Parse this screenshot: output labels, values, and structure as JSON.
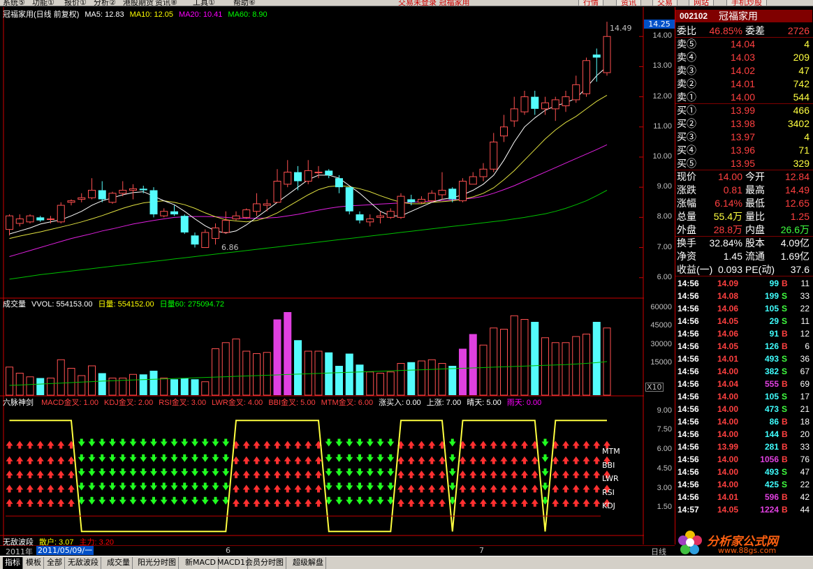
{
  "menu": {
    "items": [
      "系统⑤",
      "功能①",
      "报价①",
      "分析②",
      "港股期货",
      "资讯⑧",
      "工具①",
      "帮助⑥"
    ],
    "status": "交易未登录  冠福家用",
    "buttons": [
      "行情",
      "资讯",
      "交易",
      "网站",
      "手机炒股"
    ]
  },
  "stock": {
    "code": "002102",
    "name": "冠福家用"
  },
  "price_header": {
    "title": "冠福家用(日线 前复权)",
    "ma5": "MA5: 12.83",
    "ma10": "MA10: 12.05",
    "ma20": "MA20: 10.41",
    "ma60": "MA60: 8.90",
    "current_tag": "14.25",
    "high_label": "14.49",
    "low_label": "6.86"
  },
  "vol_header": {
    "title": "成交量",
    "vvol": "VVOL: 554153.00",
    "day": "日量: 554152.00",
    "day60": "日量60: 275094.72",
    "x10": "X10"
  },
  "ind_header": {
    "title": "六脉神剑",
    "items": [
      "MACD金叉: 1.00",
      "KDJ金叉: 2.00",
      "RSI金叉: 3.00",
      "LWR金叉: 4.00",
      "BBI金叉: 5.00",
      "MTM金叉: 6.00",
      "涨买入: 0.00",
      "上涨: 7.00",
      "晴天: 5.00",
      "雨天: 0.00"
    ]
  },
  "ind_labels": [
    "MTM",
    "BBI",
    "LWR",
    "RSI",
    "KDJ"
  ],
  "bottom_ind": {
    "title": "无敌波段",
    "retail": "散户: 3.07",
    "main": "主力: 3.20"
  },
  "price_axis": [
    "14.00",
    "13.00",
    "12.00",
    "11.00",
    "10.00",
    "9.00",
    "8.00",
    "7.00",
    "6.00"
  ],
  "vol_axis": [
    "60000",
    "45000",
    "30000",
    "15000"
  ],
  "ind_axis": [
    "9.00",
    "7.50",
    "6.00",
    "4.50",
    "3.00",
    "1.50"
  ],
  "date_bar": {
    "year": "2011年",
    "date_input": "2011/05/09/一",
    "m6": "6",
    "m7": "7",
    "period": "日线"
  },
  "panel": {
    "weibi": {
      "label": "委比",
      "value": "46.85%",
      "label2": "委差",
      "value2": "2726"
    },
    "asks": [
      {
        "label": "卖⑤",
        "price": "14.04",
        "vol": "4"
      },
      {
        "label": "卖④",
        "price": "14.03",
        "vol": "209"
      },
      {
        "label": "卖③",
        "price": "14.02",
        "vol": "47"
      },
      {
        "label": "卖②",
        "price": "14.01",
        "vol": "742"
      },
      {
        "label": "卖①",
        "price": "14.00",
        "vol": "544"
      }
    ],
    "bids": [
      {
        "label": "买①",
        "price": "13.99",
        "vol": "466"
      },
      {
        "label": "买②",
        "price": "13.98",
        "vol": "3402"
      },
      {
        "label": "买③",
        "price": "13.97",
        "vol": "4"
      },
      {
        "label": "买④",
        "price": "13.96",
        "vol": "71"
      },
      {
        "label": "买⑤",
        "price": "13.95",
        "vol": "329"
      }
    ],
    "quote": [
      {
        "l1": "现价",
        "v1": "14.00",
        "l2": "今开",
        "v2": "12.84"
      },
      {
        "l1": "涨跌",
        "v1": "0.81",
        "l2": "最高",
        "v2": "14.49"
      },
      {
        "l1": "涨幅",
        "v1": "6.14%",
        "l2": "最低",
        "v2": "12.65"
      },
      {
        "l1": "总量",
        "v1": "55.4万",
        "l2": "量比",
        "v2": "1.25"
      },
      {
        "l1": "外盘",
        "v1": "28.8万",
        "l2": "内盘",
        "v2": "26.6万"
      }
    ],
    "fund": [
      {
        "l1": "换手",
        "v1": "32.84%",
        "l2": "股本",
        "v2": "4.09亿"
      },
      {
        "l1": "净资",
        "v1": "1.45",
        "l2": "流通",
        "v2": "1.69亿"
      },
      {
        "l1": "收益(一)",
        "v1": "0.093",
        "l2": "PE(动)",
        "v2": "37.6"
      }
    ],
    "ticks": [
      {
        "t": "14:56",
        "p": "14.09",
        "v": "99",
        "s": "B",
        "n": "11"
      },
      {
        "t": "14:56",
        "p": "14.08",
        "v": "199",
        "s": "S",
        "n": "33"
      },
      {
        "t": "14:56",
        "p": "14.06",
        "v": "105",
        "s": "S",
        "n": "22"
      },
      {
        "t": "14:56",
        "p": "14.05",
        "v": "29",
        "s": "S",
        "n": "11"
      },
      {
        "t": "14:56",
        "p": "14.06",
        "v": "91",
        "s": "B",
        "n": "12"
      },
      {
        "t": "14:56",
        "p": "14.05",
        "v": "126",
        "s": "B",
        "n": "6"
      },
      {
        "t": "14:56",
        "p": "14.01",
        "v": "493",
        "s": "S",
        "n": "36"
      },
      {
        "t": "14:56",
        "p": "14.00",
        "v": "382",
        "s": "S",
        "n": "67"
      },
      {
        "t": "14:56",
        "p": "14.04",
        "v": "555",
        "s": "B",
        "n": "69"
      },
      {
        "t": "14:56",
        "p": "14.00",
        "v": "105",
        "s": "S",
        "n": "17"
      },
      {
        "t": "14:56",
        "p": "14.00",
        "v": "473",
        "s": "S",
        "n": "21"
      },
      {
        "t": "14:56",
        "p": "14.00",
        "v": "86",
        "s": "B",
        "n": "18"
      },
      {
        "t": "14:56",
        "p": "14.00",
        "v": "144",
        "s": "B",
        "n": "20"
      },
      {
        "t": "14:56",
        "p": "13.99",
        "v": "281",
        "s": "B",
        "n": "33"
      },
      {
        "t": "14:56",
        "p": "14.00",
        "v": "1056",
        "s": "B",
        "n": "76"
      },
      {
        "t": "14:56",
        "p": "14.00",
        "v": "493",
        "s": "S",
        "n": "47"
      },
      {
        "t": "14:56",
        "p": "14.00",
        "v": "425",
        "s": "S",
        "n": "22"
      },
      {
        "t": "14:56",
        "p": "14.01",
        "v": "596",
        "s": "B",
        "n": "42"
      },
      {
        "t": "14:57",
        "p": "14.05",
        "v": "1224",
        "s": "B",
        "n": "44"
      }
    ]
  },
  "watermark": {
    "site": "分析家公式网",
    "url": "www.88gs.com"
  },
  "bottom_tabs": [
    "指标",
    "模板",
    "全部",
    "无敌波段",
    "成交量",
    "阳光分时图",
    "新MACD",
    "MACD1",
    "会员分时图",
    "超级解盘"
  ],
  "chart_data": {
    "type": "candlestick",
    "ylim": [
      5.6,
      14.7
    ],
    "candles": [
      [
        7.6,
        8.05,
        7.4,
        8.1
      ],
      [
        7.8,
        7.95,
        7.7,
        8.1
      ],
      [
        7.85,
        8.05,
        7.8,
        8.1
      ],
      [
        8.0,
        7.9,
        7.85,
        8.05
      ],
      [
        7.95,
        7.95,
        7.8,
        8.05
      ],
      [
        7.85,
        8.4,
        7.8,
        8.5
      ],
      [
        8.5,
        8.55,
        8.4,
        8.6
      ],
      [
        8.6,
        8.65,
        8.5,
        8.8
      ],
      [
        8.65,
        8.9,
        8.6,
        9.3
      ],
      [
        8.9,
        8.6,
        8.5,
        9.2
      ],
      [
        8.5,
        8.8,
        8.45,
        8.85
      ],
      [
        8.8,
        8.9,
        8.7,
        9.2
      ],
      [
        8.9,
        8.95,
        8.6,
        9.1
      ],
      [
        8.95,
        8.9,
        8.8,
        9.05
      ],
      [
        8.9,
        8.1,
        8.0,
        9.0
      ],
      [
        8.05,
        8.2,
        8.0,
        8.3
      ],
      [
        8.2,
        8.1,
        8.05,
        8.4
      ],
      [
        8.05,
        7.5,
        7.45,
        8.1
      ],
      [
        7.4,
        7.1,
        7.0,
        7.5
      ],
      [
        7.0,
        7.5,
        7.0,
        7.6
      ],
      [
        7.3,
        7.65,
        7.1,
        7.8
      ],
      [
        7.5,
        7.9,
        7.45,
        8.2
      ],
      [
        7.95,
        8.05,
        7.9,
        8.2
      ],
      [
        8.0,
        8.25,
        7.95,
        8.3
      ],
      [
        8.2,
        8.45,
        8.05,
        8.8
      ],
      [
        8.4,
        8.45,
        8.2,
        8.6
      ],
      [
        8.5,
        9.2,
        8.5,
        9.6
      ],
      [
        9.1,
        9.5,
        9.0,
        9.9
      ],
      [
        9.5,
        9.2,
        8.9,
        9.7
      ],
      [
        9.2,
        9.55,
        9.1,
        9.9
      ],
      [
        9.5,
        9.5,
        9.3,
        9.7
      ],
      [
        9.55,
        9.4,
        9.3,
        9.6
      ],
      [
        9.3,
        9.0,
        8.8,
        9.4
      ],
      [
        9.0,
        8.2,
        8.1,
        9.0
      ],
      [
        8.1,
        7.9,
        7.8,
        8.2
      ],
      [
        7.85,
        7.95,
        7.7,
        8.1
      ],
      [
        8.0,
        8.05,
        7.8,
        8.2
      ],
      [
        8.0,
        8.2,
        7.95,
        8.3
      ],
      [
        8.0,
        8.7,
        7.95,
        8.8
      ],
      [
        8.6,
        8.5,
        8.4,
        8.75
      ],
      [
        8.5,
        8.6,
        8.45,
        8.7
      ],
      [
        8.55,
        8.8,
        8.5,
        8.9
      ],
      [
        8.75,
        8.9,
        8.6,
        9.5
      ],
      [
        8.95,
        8.6,
        8.5,
        9.0
      ],
      [
        8.55,
        9.2,
        8.5,
        9.3
      ],
      [
        9.1,
        9.35,
        9.1,
        9.5
      ],
      [
        9.35,
        9.6,
        9.2,
        9.8
      ],
      [
        9.6,
        10.5,
        9.5,
        10.8
      ],
      [
        10.7,
        11.0,
        10.5,
        11.4
      ],
      [
        11.2,
        11.6,
        11.0,
        12.0
      ],
      [
        11.5,
        12.0,
        11.4,
        12.2
      ],
      [
        12.0,
        11.6,
        11.4,
        12.2
      ],
      [
        11.6,
        11.8,
        11.4,
        12.0
      ],
      [
        11.6,
        11.9,
        11.2,
        12.0
      ],
      [
        11.7,
        12.0,
        11.5,
        12.2
      ],
      [
        11.9,
        12.4,
        11.8,
        12.7
      ],
      [
        12.1,
        13.2,
        12.0,
        13.3
      ],
      [
        13.4,
        13.3,
        12.5,
        13.6
      ],
      [
        12.8,
        14.0,
        12.7,
        14.49
      ]
    ],
    "ma5": [
      7.45,
      7.55,
      7.65,
      7.78,
      7.85,
      7.92,
      8.05,
      8.2,
      8.4,
      8.55,
      8.65,
      8.75,
      8.82,
      8.85,
      8.7,
      8.55,
      8.42,
      8.2,
      7.95,
      7.72,
      7.55,
      7.48,
      7.55,
      7.75,
      8.0,
      8.25,
      8.5,
      8.75,
      9.0,
      9.25,
      9.4,
      9.4,
      9.3,
      9.05,
      8.8,
      8.5,
      8.2,
      8.05,
      8.05,
      8.2,
      8.35,
      8.5,
      8.6,
      8.65,
      8.75,
      8.9,
      9.1,
      9.4,
      9.9,
      10.5,
      11.0,
      11.3,
      11.55,
      11.7,
      11.8,
      11.95,
      12.3,
      12.7,
      13.0
    ],
    "ma10": [
      7.3,
      7.38,
      7.45,
      7.52,
      7.6,
      7.68,
      7.76,
      7.85,
      7.95,
      8.06,
      8.18,
      8.3,
      8.4,
      8.48,
      8.52,
      8.55,
      8.5,
      8.42,
      8.3,
      8.15,
      8.02,
      7.92,
      7.88,
      7.85,
      7.9,
      8.0,
      8.15,
      8.35,
      8.55,
      8.75,
      8.92,
      9.02,
      9.05,
      9.02,
      8.95,
      8.85,
      8.72,
      8.6,
      8.5,
      8.45,
      8.45,
      8.5,
      8.52,
      8.55,
      8.6,
      8.68,
      8.8,
      8.98,
      9.25,
      9.55,
      9.9,
      10.25,
      10.6,
      10.9,
      11.15,
      11.35,
      11.6,
      11.85,
      12.05
    ],
    "ma20": [
      6.7,
      6.8,
      6.9,
      7.0,
      7.1,
      7.2,
      7.3,
      7.38,
      7.46,
      7.55,
      7.62,
      7.7,
      7.78,
      7.84,
      7.9,
      7.95,
      8.0,
      8.02,
      8.03,
      8.03,
      8.02,
      8.0,
      7.98,
      7.97,
      7.97,
      7.98,
      8.0,
      8.05,
      8.1,
      8.17,
      8.24,
      8.3,
      8.35,
      8.38,
      8.4,
      8.42,
      8.44,
      8.46,
      8.48,
      8.5,
      8.52,
      8.54,
      8.56,
      8.58,
      8.6,
      8.64,
      8.7,
      8.8,
      8.92,
      9.05,
      9.2,
      9.35,
      9.5,
      9.65,
      9.8,
      9.95,
      10.1,
      10.25,
      10.41
    ],
    "ma60": [
      5.95,
      6.0,
      6.05,
      6.1,
      6.14,
      6.18,
      6.22,
      6.26,
      6.3,
      6.34,
      6.38,
      6.42,
      6.46,
      6.5,
      6.54,
      6.58,
      6.62,
      6.66,
      6.7,
      6.74,
      6.78,
      6.82,
      6.86,
      6.9,
      6.94,
      6.98,
      7.02,
      7.06,
      7.1,
      7.14,
      7.18,
      7.22,
      7.26,
      7.3,
      7.34,
      7.38,
      7.42,
      7.46,
      7.5,
      7.54,
      7.58,
      7.62,
      7.66,
      7.7,
      7.74,
      7.78,
      7.82,
      7.86,
      7.9,
      7.95,
      8.0,
      8.06,
      8.12,
      8.2,
      8.3,
      8.42,
      8.55,
      8.72,
      8.9
    ],
    "volume_ylim": [
      0,
      68000
    ],
    "volume": [
      23000,
      18000,
      15000,
      14000,
      14000,
      29000,
      22000,
      16000,
      24000,
      18000,
      14000,
      14000,
      17000,
      17000,
      20000,
      14000,
      13000,
      14000,
      13000,
      11000,
      38000,
      43000,
      46000,
      36000,
      34000,
      35000,
      62000,
      68000,
      45000,
      36000,
      36000,
      35000,
      24000,
      34000,
      25000,
      19000,
      18000,
      19000,
      26000,
      27000,
      28000,
      29000,
      26000,
      24000,
      38000,
      50000,
      41000,
      55000,
      54000,
      65000,
      62000,
      60000,
      47000,
      43000,
      43000,
      48000,
      50000,
      60000,
      55000
    ],
    "vol_ma60": [
      8000,
      8300,
      8700,
      9100,
      9500,
      9900,
      10300,
      10700,
      11100,
      11500,
      11800,
      12100,
      12400,
      12700,
      13000,
      13300,
      13600,
      13900,
      14200,
      14500,
      14800,
      15100,
      15400,
      15700,
      16000,
      16300,
      16600,
      16900,
      17200,
      17500,
      17800,
      18100,
      18400,
      18700,
      19000,
      19300,
      19600,
      19900,
      20200,
      20500,
      20800,
      21100,
      21400,
      21700,
      22000,
      22300,
      22600,
      22900,
      23200,
      23500,
      23800,
      24100,
      24400,
      24700,
      25000,
      25500,
      26000,
      26600,
      27500
    ]
  }
}
